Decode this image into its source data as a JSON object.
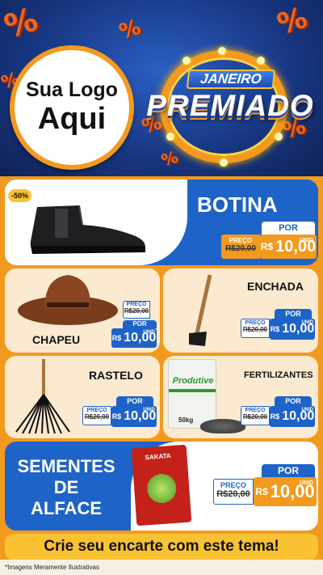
{
  "header": {
    "logo_line1": "Sua Logo",
    "logo_line2": "Aqui",
    "badge_small": "JANEIRO",
    "badge_big": "PREMIADO",
    "percent_symbol": "%"
  },
  "products": [
    {
      "name": "BOTINA",
      "discount_tag": "-50%",
      "preco_label": "PREÇO",
      "old_price": "R$20,00",
      "por_label": "POR",
      "currency": "R$",
      "new_price": "10,00",
      "unit": "UNID"
    },
    {
      "name": "CHAPEU",
      "preco_label": "PREÇO",
      "old_price": "R$20,00",
      "por_label": "POR",
      "currency": "R$",
      "new_price": "10,00",
      "unit": "UNID"
    },
    {
      "name": "ENCHADA",
      "preco_label": "PREÇO",
      "old_price": "R$20,00",
      "por_label": "POR",
      "currency": "R$",
      "new_price": "10,00",
      "unit": "UNID"
    },
    {
      "name": "RASTELO",
      "preco_label": "PREÇO",
      "old_price": "R$20,00",
      "por_label": "POR",
      "currency": "R$",
      "new_price": "10,00",
      "unit": "UNID"
    },
    {
      "name": "FERTILIZANTES",
      "preco_label": "PREÇO",
      "old_price": "R$20,00",
      "por_label": "POR",
      "currency": "R$",
      "new_price": "10,00",
      "unit": "UNID",
      "bag_brand": "Produtive",
      "bag_weight": "50kg"
    },
    {
      "name_line1": "SEMENTES",
      "name_line2": "DE",
      "name_line3": "ALFACE",
      "preco_label": "PREÇO",
      "old_price": "R$20,00",
      "por_label": "POR",
      "currency": "R$",
      "new_price": "10,00",
      "unit": "UNID",
      "packet_brand": "SAKATA"
    }
  ],
  "cta": "Crie seu encarte com este tema!",
  "footnote": "*Imagens Meramente Ilustrativas",
  "colors": {
    "blue": "#1e63c7",
    "orange": "#f29a1e",
    "navy": "#17357f",
    "yellow": "#f9c233"
  }
}
